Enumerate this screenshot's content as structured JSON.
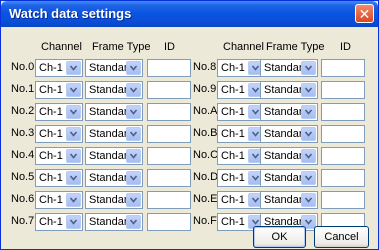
{
  "window": {
    "title": "Watch data settings"
  },
  "headers": {
    "channel": "Channel",
    "frame_type": "Frame Type",
    "id": "ID"
  },
  "left_rows": [
    {
      "label": "No.0",
      "channel": "Ch-1",
      "frame_type": "Standard",
      "id": ""
    },
    {
      "label": "No.1",
      "channel": "Ch-1",
      "frame_type": "Standard",
      "id": ""
    },
    {
      "label": "No.2",
      "channel": "Ch-1",
      "frame_type": "Standard",
      "id": ""
    },
    {
      "label": "No.3",
      "channel": "Ch-1",
      "frame_type": "Standard",
      "id": ""
    },
    {
      "label": "No.4",
      "channel": "Ch-1",
      "frame_type": "Standard",
      "id": ""
    },
    {
      "label": "No.5",
      "channel": "Ch-1",
      "frame_type": "Standard",
      "id": ""
    },
    {
      "label": "No.6",
      "channel": "Ch-1",
      "frame_type": "Standard",
      "id": ""
    },
    {
      "label": "No.7",
      "channel": "Ch-1",
      "frame_type": "Standard",
      "id": ""
    }
  ],
  "right_rows": [
    {
      "label": "No.8",
      "channel": "Ch-1",
      "frame_type": "Standard",
      "id": ""
    },
    {
      "label": "No.9",
      "channel": "Ch-1",
      "frame_type": "Standard",
      "id": ""
    },
    {
      "label": "No.A",
      "channel": "Ch-1",
      "frame_type": "Standard",
      "id": ""
    },
    {
      "label": "No.B",
      "channel": "Ch-1",
      "frame_type": "Standard",
      "id": ""
    },
    {
      "label": "No.C",
      "channel": "Ch-1",
      "frame_type": "Standard",
      "id": ""
    },
    {
      "label": "No.D",
      "channel": "Ch-1",
      "frame_type": "Standard",
      "id": ""
    },
    {
      "label": "No.E",
      "channel": "Ch-1",
      "frame_type": "Standard",
      "id": ""
    },
    {
      "label": "No.F",
      "channel": "Ch-1",
      "frame_type": "Standard",
      "id": ""
    }
  ],
  "buttons": {
    "ok": "OK",
    "cancel": "Cancel"
  },
  "icons": {
    "close": "close-icon",
    "dropdown": "chevron-down-icon"
  },
  "colors": {
    "titlebar": "#0a4ed6",
    "close": "#d9481f",
    "face": "#ece9d8",
    "field_border": "#7f9db9"
  }
}
